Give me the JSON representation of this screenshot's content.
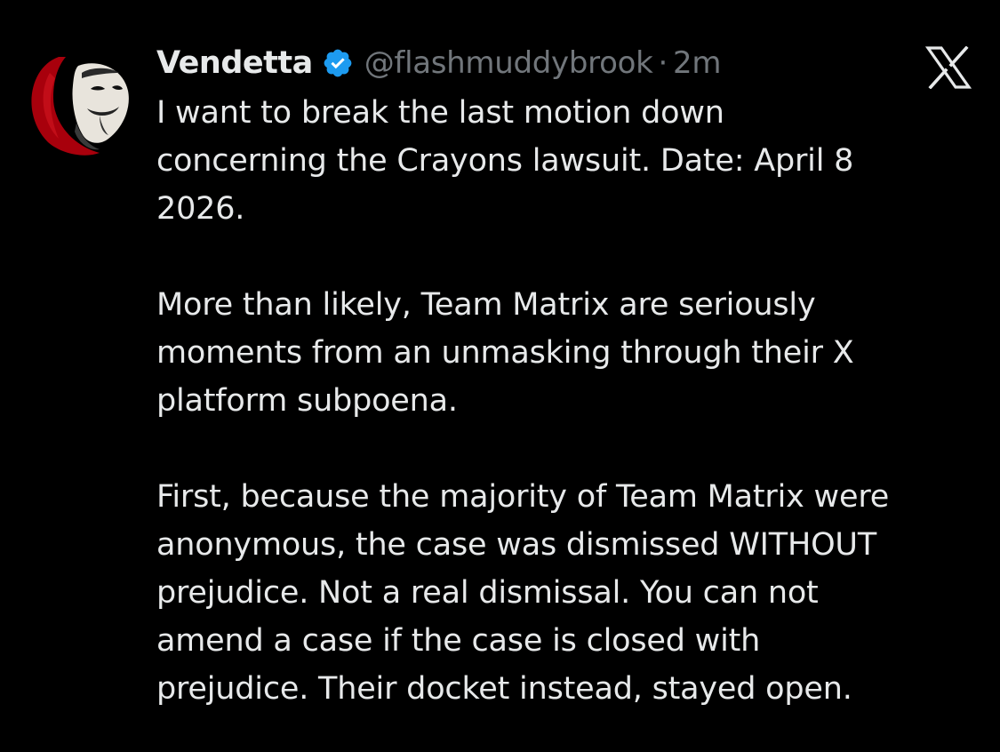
{
  "tweet": {
    "author": {
      "display_name": "Vendetta",
      "handle": "@flashmuddybrook",
      "verified": true,
      "avatar": "guy-fawkes-mask-red-crescent-avatar"
    },
    "separator": "·",
    "timestamp": "2m",
    "brand_icon": "x-logo-icon",
    "paragraphs": [
      "I want to break the last motion down\nconcerning the Crayons lawsuit.  Date: April 8\n2026.",
      "More than likely, Team Matrix are seriously\nmoments from an unmasking through their X\nplatform subpoena.",
      "First, because the majority of Team Matrix were\nanonymous, the case was dismissed  WITHOUT\nprejudice. Not a real dismissal. You can not\namend a case if the case is closed with\nprejudice. Their docket instead, stayed open."
    ]
  },
  "colors": {
    "background": "#000000",
    "primary_text": "#e7e9ea",
    "secondary_text": "#71767b",
    "verified_badge": "#1d9bf0",
    "avatar_accent": "#b0000f"
  }
}
